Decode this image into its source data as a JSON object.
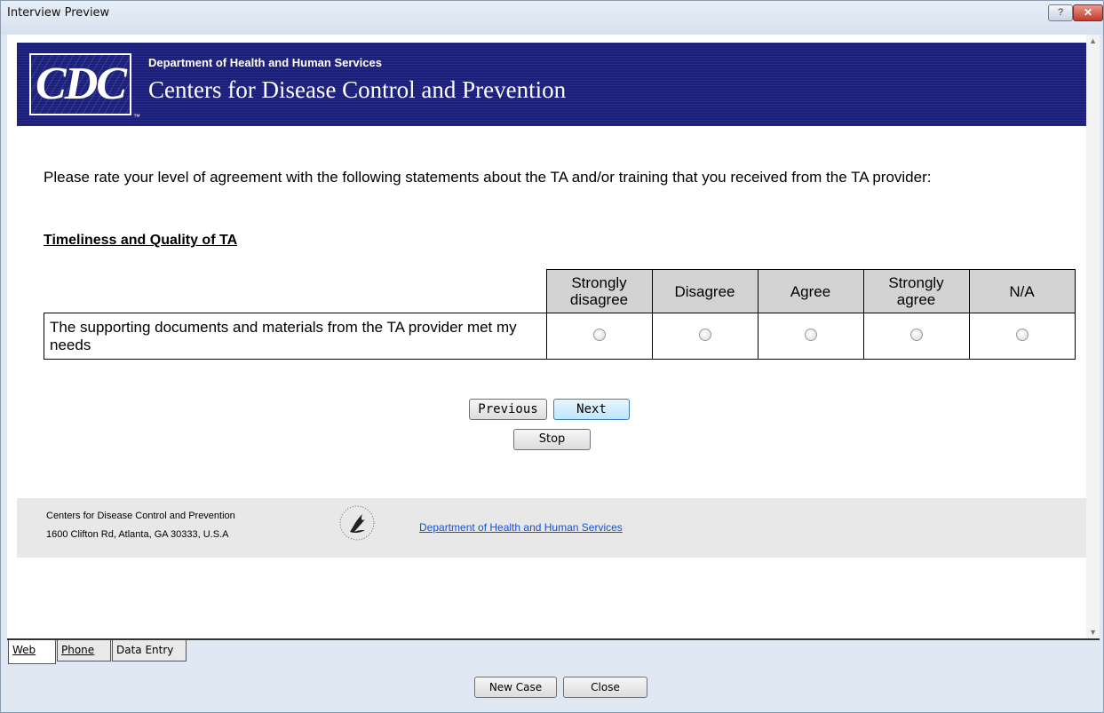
{
  "window": {
    "title": "Interview Preview"
  },
  "header": {
    "logo_text": "CDC",
    "department": "Department of Health and Human Services",
    "agency": "Centers for Disease Control and Prevention"
  },
  "survey": {
    "question": "Please rate your level of agreement with the following statements about the TA and/or training that you received from the TA provider:",
    "section_title": "Timeliness and Quality of TA",
    "columns": [
      "Strongly disagree",
      "Disagree",
      "Agree",
      "Strongly agree",
      "N/A"
    ],
    "statement": "The supporting documents and materials from the TA provider met my needs"
  },
  "navigation": {
    "previous": "Previous",
    "next": "Next",
    "stop": "Stop"
  },
  "footer": {
    "org_name": "Centers for Disease Control and Prevention",
    "address": "1600 Clifton Rd, Atlanta, GA 30333, U.S.A",
    "link": "Department of Health and Human Services"
  },
  "tabs": [
    "Web",
    "Phone",
    "Data Entry"
  ],
  "actions": {
    "new_case": "New Case",
    "close": "Close"
  },
  "colors": {
    "banner": "#1b1f7b",
    "header_cell": "#d3d3d3",
    "footer_band": "#e8e8e8",
    "link": "#1a4fd0"
  }
}
